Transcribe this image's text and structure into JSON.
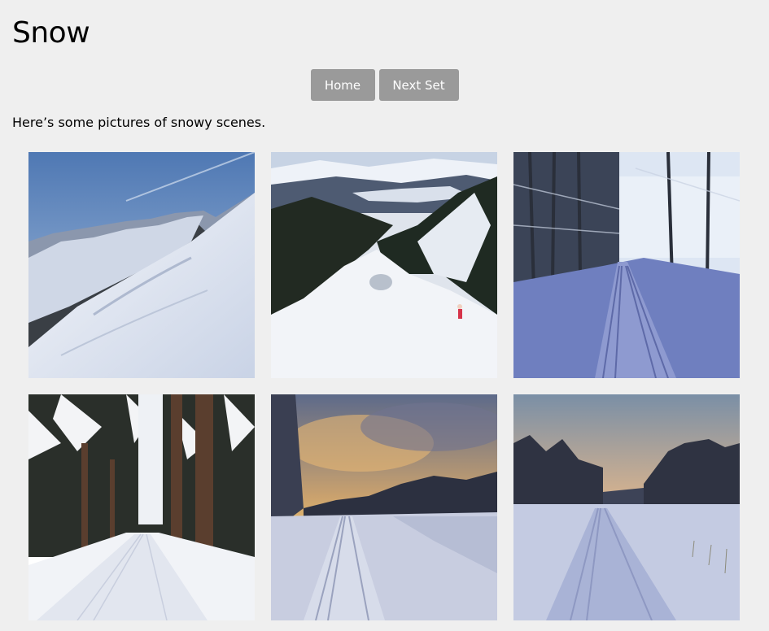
{
  "page": {
    "title": "Snow",
    "intro": "Here’s some pictures of snowy scenes."
  },
  "nav": {
    "home_label": "Home",
    "next_label": "Next Set"
  },
  "colors": {
    "background": "#efefef",
    "button_bg": "#9a9a9a",
    "button_text": "#ffffff"
  },
  "gallery": {
    "photos": [
      {
        "subject": "snowy mountain ridge under blue sky"
      },
      {
        "subject": "skier on snowy slope with forested valley"
      },
      {
        "subject": "groomed ski trail through winter trees"
      },
      {
        "subject": "snowy forest path with tall pines"
      },
      {
        "subject": "sunset over snowy field with ski tracks"
      },
      {
        "subject": "dusk snowy field with tree line"
      }
    ]
  }
}
